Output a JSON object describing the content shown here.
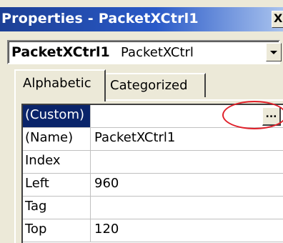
{
  "window": {
    "title": "Properties - PacketXCtrl1",
    "close_label": "X"
  },
  "object_selector": {
    "name": "PacketXCtrl1",
    "type": "PacketXCtrl"
  },
  "tabs": [
    {
      "label": "Alphabetic",
      "active": true
    },
    {
      "label": "Categorized",
      "active": false
    }
  ],
  "properties": [
    {
      "name": "(Custom)",
      "value": "",
      "selected": true,
      "has_button": true,
      "button_label": "..."
    },
    {
      "name": "(Name)",
      "value": "PacketXCtrl1"
    },
    {
      "name": "Index",
      "value": ""
    },
    {
      "name": "Left",
      "value": "960"
    },
    {
      "name": "Tag",
      "value": ""
    },
    {
      "name": "Top",
      "value": "120"
    }
  ],
  "colors": {
    "title_bar": "#1c3f95",
    "selection": "#0a246a",
    "highlight_annotation": "#e0202a",
    "face": "#ece9d8"
  }
}
